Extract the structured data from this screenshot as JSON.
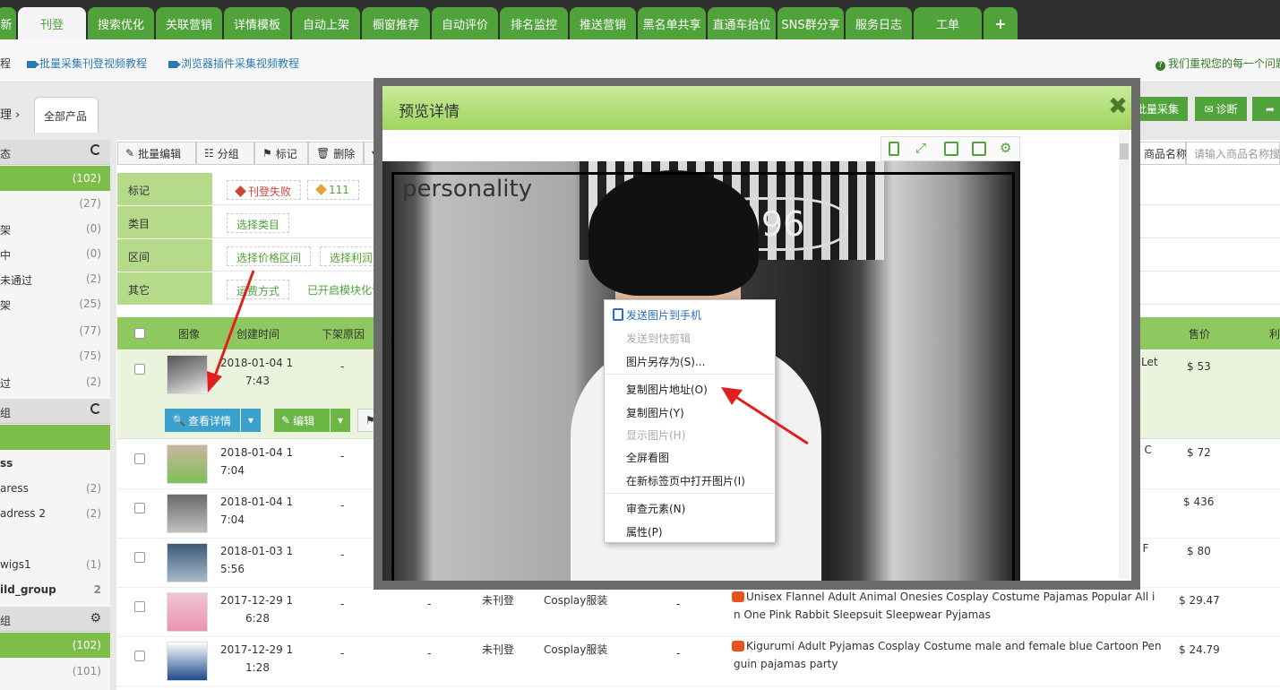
{
  "nav": {
    "tabs": [
      "新",
      "刊登",
      "搜索优化",
      "关联营销",
      "详情模板",
      "自动上架",
      "橱窗推荐",
      "自动评价",
      "排名监控",
      "推送营销",
      "黑名单共享",
      "直通车拾位",
      "SNS群分享",
      "服务日志",
      "工单",
      "+"
    ]
  },
  "subbar": {
    "link0": "程",
    "link1": "批量采集刊登视频教程",
    "link2": "浏览器插件采集视频教程",
    "notice": "我们重视您的每一个问题"
  },
  "crumb": {
    "prev": "理 ›",
    "current": "全部产品"
  },
  "sidebar": {
    "status_head": "态",
    "status": [
      {
        "label": "",
        "count": "(102)"
      },
      {
        "label": "",
        "count": "(27)"
      },
      {
        "label": "架",
        "count": "(0)"
      },
      {
        "label": "中",
        "count": "(0)"
      },
      {
        "label": "未通过",
        "count": "(2)"
      },
      {
        "label": "架",
        "count": "(25)"
      },
      {
        "label": "",
        "count": "(77)"
      },
      {
        "label": "",
        "count": "(75)"
      },
      {
        "label": "过",
        "count": "(2)"
      }
    ],
    "group_head": "组",
    "groups": [
      {
        "label": "",
        "count": ""
      },
      {
        "label": "ss",
        "count": ""
      },
      {
        "label": "aress",
        "count": "(2)"
      },
      {
        "label": "adress 2",
        "count": "(2)"
      },
      {
        "label": "",
        "count": ""
      },
      {
        "label": "wigs1",
        "count": "(1)"
      },
      {
        "label": "ild_group",
        "count": "2"
      }
    ],
    "group2_head": "组",
    "group2": [
      {
        "label": "",
        "count": "(102)"
      },
      {
        "label": "",
        "count": "(101)"
      }
    ]
  },
  "toolbar": {
    "batch_edit": "批量编辑",
    "group": "分组",
    "tag": "标记",
    "delete": "删除"
  },
  "filters": {
    "tag_label": "标记",
    "tag_opt1": "刊登失败",
    "tag_opt2": "111",
    "cat_label": "类目",
    "cat_opt": "选择类目",
    "range_label": "区间",
    "range_opt1": "选择价格区间",
    "range_opt2": "选择利润区",
    "other_label": "其它",
    "other_opt1": "运费方式",
    "other_opt2": "已开启模块化详"
  },
  "table": {
    "headers": {
      "image": "图像",
      "created": "创建时间",
      "reason": "下架原因",
      "price": "售价",
      "more": "利"
    },
    "rows": [
      {
        "date1": "2018-01-04 1",
        "date2": "7:43",
        "reason": "-",
        "title_tail": "Let",
        "price": "$ 53",
        "status": "",
        "cat": "",
        "sep": "",
        "title1": "",
        "title2": ""
      },
      {
        "date1": "2018-01-04 1",
        "date2": "7:04",
        "reason": "-",
        "title_tail": "m C",
        "price": "$ 72",
        "status": "",
        "cat": "",
        "sep": "",
        "title1": "",
        "title2": ""
      },
      {
        "date1": "2018-01-04 1",
        "date2": "7:04",
        "reason": "-",
        "title_tail": "",
        "price": "$ 436",
        "status": "",
        "cat": "",
        "sep": "",
        "title1": "",
        "title2": ""
      },
      {
        "date1": "2018-01-03 1",
        "date2": "5:56",
        "reason": "-",
        "title_tail": "le F",
        "price": "$ 80",
        "status": "",
        "cat": "",
        "sep": "",
        "title1": "",
        "title2": ""
      },
      {
        "date1": "2017-12-29 1",
        "date2": "6:28",
        "reason": "-",
        "dash": "-",
        "status": "未刊登",
        "cat": "Cosplay服装",
        "sep": "-",
        "title1": "Unisex  Flannel Adult Animal Onesies Cosplay Costume Pajamas Popular All i",
        "title2": "n One Pink Rabbit Sleepsuit Sleepwear Pyjamas",
        "price": "$ 29.47"
      },
      {
        "date1": "2017-12-29 1",
        "date2": "1:28",
        "reason": "-",
        "dash": "-",
        "status": "未刊登",
        "cat": "Cosplay服装",
        "sep": "-",
        "title1": "Kigurumi Adult Pyjamas Cosplay Costume male and female blue Cartoon Pen",
        "title2": "guin pajamas party",
        "price": "$ 24.79"
      }
    ]
  },
  "actions": {
    "view": "查看详情",
    "edit": "编辑"
  },
  "right": {
    "batch_collect": "批量采集",
    "diagnose": "诊断",
    "search_field": "商品名称",
    "search_placeholder": "请输入商品名称搜"
  },
  "modal": {
    "title": "预览详情",
    "image_text": "personality",
    "sign_text": "996"
  },
  "context_menu": {
    "send_phone": "发送图片到手机",
    "send_clip": "发送到快剪辑",
    "save_as": "图片另存为(S)...",
    "copy_addr": "复制图片地址(O)",
    "copy_img": "复制图片(Y)",
    "show_img": "显示图片(H)",
    "fullscreen": "全屏看图",
    "open_tab": "在新标签页中打开图片(I)",
    "inspect": "审查元素(N)",
    "props": "属性(P)"
  }
}
